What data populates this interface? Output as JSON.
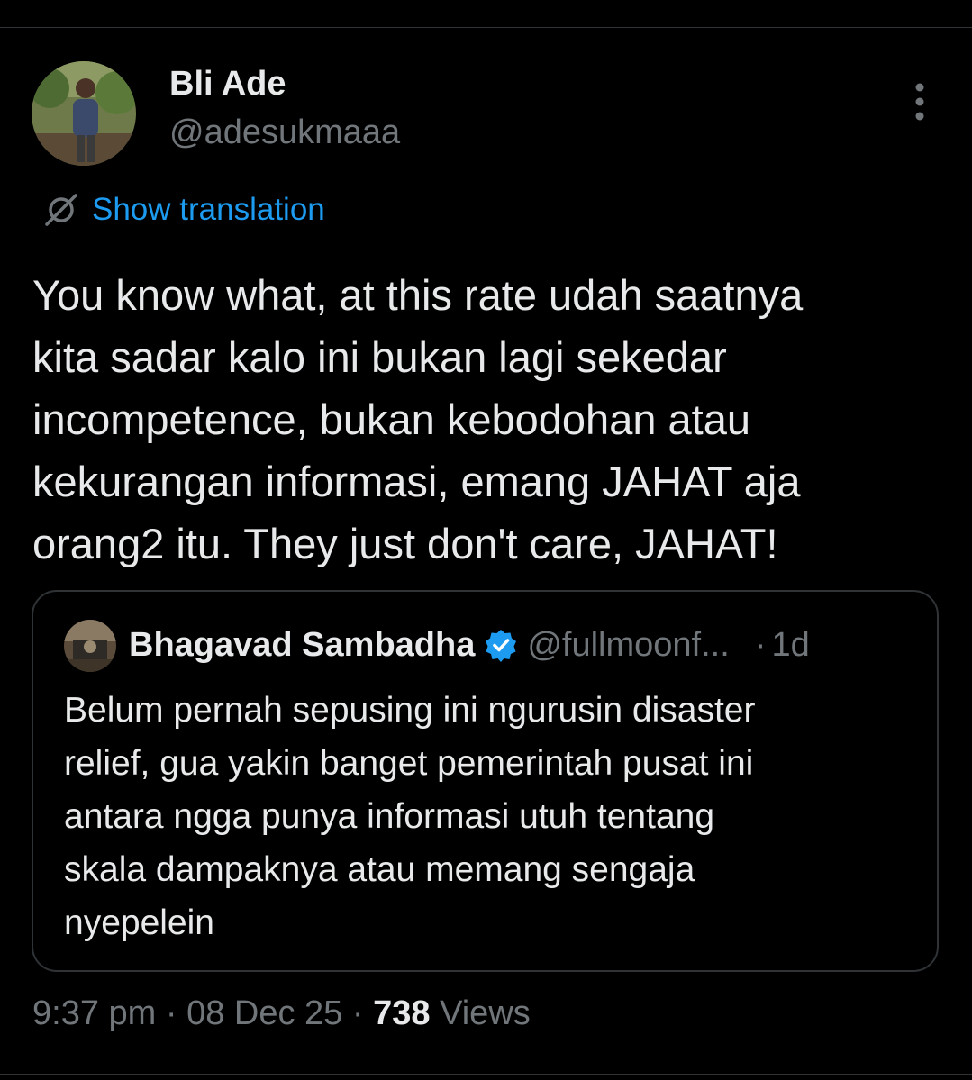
{
  "author": {
    "display_name": "Bli Ade",
    "handle": "@adesukmaaa",
    "more_icon": "more-vertical-icon"
  },
  "translation": {
    "icon": "globe-icon",
    "label": "Show translation"
  },
  "tweet": {
    "lines": [
      "You know what, at this rate udah saatnya",
      "kita sadar kalo ini bukan lagi sekedar",
      "incompetence, bukan kebodohan atau",
      "kekurangan informasi, emang JAHAT aja",
      "orang2 itu. They just don't care, JAHAT!"
    ]
  },
  "quoted_tweet": {
    "display_name": "Bhagavad Sambadha",
    "verified": true,
    "handle": "@fullmoonf...",
    "separator": "·",
    "time": "1d",
    "lines": [
      "Belum pernah sepusing ini ngurusin disaster",
      "relief, gua yakin banget pemerintah pusat ini",
      "antara ngga punya informasi utuh tentang",
      "skala dampaknya atau memang sengaja",
      "nyepelein"
    ]
  },
  "meta": {
    "time": "9:37 pm",
    "sep1": "·",
    "date": "08 Dec 25",
    "sep2": "·",
    "views_count": "738",
    "views_label": "Views"
  },
  "colors": {
    "background": "#000000",
    "text_primary": "#e7e9ea",
    "text_secondary": "#71767b",
    "accent": "#1d9bf0",
    "border": "#2f3336"
  }
}
